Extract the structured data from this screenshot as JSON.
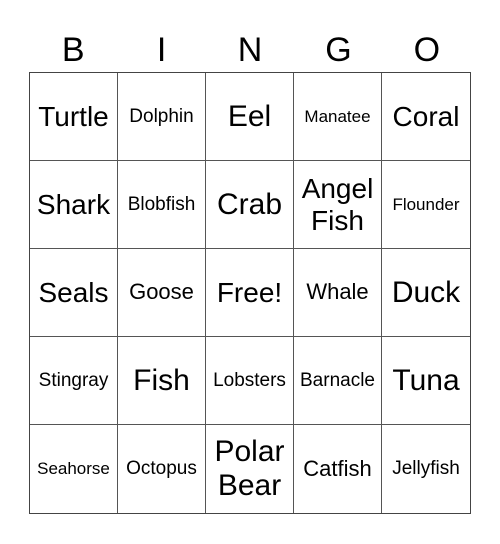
{
  "header": [
    "B",
    "I",
    "N",
    "G",
    "O"
  ],
  "cells": [
    {
      "text": "Turtle",
      "size": "s2"
    },
    {
      "text": "Dolphin",
      "size": "s4"
    },
    {
      "text": "Eel",
      "size": "s1"
    },
    {
      "text": "Manatee",
      "size": "s5"
    },
    {
      "text": "Coral",
      "size": "s2"
    },
    {
      "text": "Shark",
      "size": "s2"
    },
    {
      "text": "Blobfish",
      "size": "s4"
    },
    {
      "text": "Crab",
      "size": "s1"
    },
    {
      "text": "Angel Fish",
      "size": "s2"
    },
    {
      "text": "Flounder",
      "size": "s5"
    },
    {
      "text": "Seals",
      "size": "s2"
    },
    {
      "text": "Goose",
      "size": "s3"
    },
    {
      "text": "Free!",
      "size": "s2"
    },
    {
      "text": "Whale",
      "size": "s3"
    },
    {
      "text": "Duck",
      "size": "s1"
    },
    {
      "text": "Stingray",
      "size": "s4"
    },
    {
      "text": "Fish",
      "size": "s1"
    },
    {
      "text": "Lobsters",
      "size": "s4"
    },
    {
      "text": "Barnacle",
      "size": "s4"
    },
    {
      "text": "Tuna",
      "size": "s1"
    },
    {
      "text": "Seahorse",
      "size": "s5"
    },
    {
      "text": "Octopus",
      "size": "s4"
    },
    {
      "text": "Polar Bear",
      "size": "s1"
    },
    {
      "text": "Catfish",
      "size": "s3"
    },
    {
      "text": "Jellyfish",
      "size": "s4"
    }
  ]
}
